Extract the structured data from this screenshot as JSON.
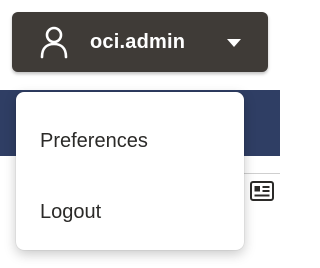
{
  "user_menu": {
    "username": "oci.admin",
    "user_icon": "user-icon",
    "caret_icon": "caret-down-icon"
  },
  "dropdown": {
    "items": [
      {
        "label": "Preferences"
      },
      {
        "label": "Logout"
      }
    ]
  },
  "background": {
    "card_icon": "id-card-icon"
  },
  "colors": {
    "button_bg": "#3f3b37",
    "nav_band": "#2f3e64",
    "menu_bg": "#ffffff",
    "menu_text": "#2b2a28"
  }
}
